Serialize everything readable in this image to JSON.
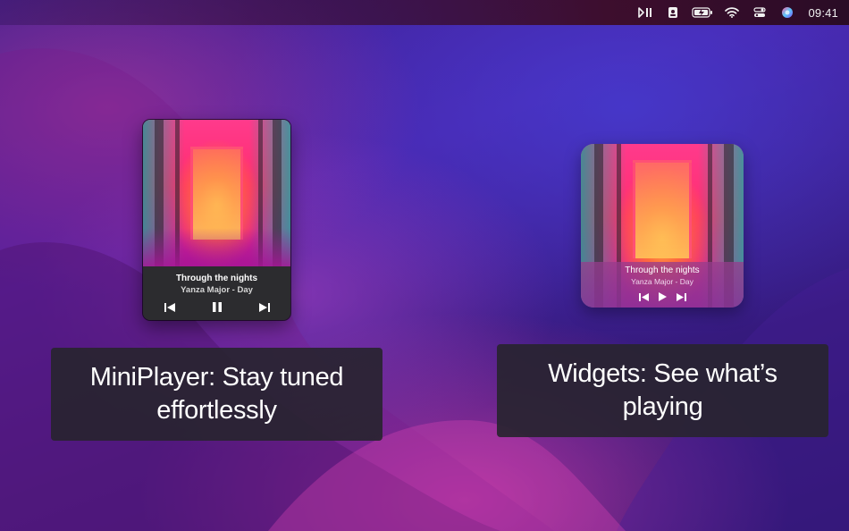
{
  "menubar": {
    "icons": [
      "play-pause-icon",
      "contact-card-icon",
      "battery-charging-icon",
      "wifi-icon",
      "control-center-icon",
      "siri-icon"
    ],
    "clock": "09:41"
  },
  "miniplayer": {
    "track_title": "Through the nights",
    "artist_line": "Yanza Major - Day",
    "controls": [
      "previous-track-icon",
      "pause-icon",
      "next-track-icon"
    ]
  },
  "widget": {
    "track_title": "Through the nights",
    "artist_line": "Yanza Major - Day",
    "controls": [
      "previous-track-icon",
      "play-icon",
      "next-track-icon"
    ]
  },
  "captions": {
    "miniplayer": "MiniPlayer: Stay tuned effortlessly",
    "widgets": "Widgets: See what’s playing"
  },
  "colors": {
    "wallpaper": "#4a23a8",
    "caption_bg": "#28242f",
    "player_bg": "#2d2d30",
    "art_pink": "#ff2d6e",
    "art_teal": "#289696"
  }
}
